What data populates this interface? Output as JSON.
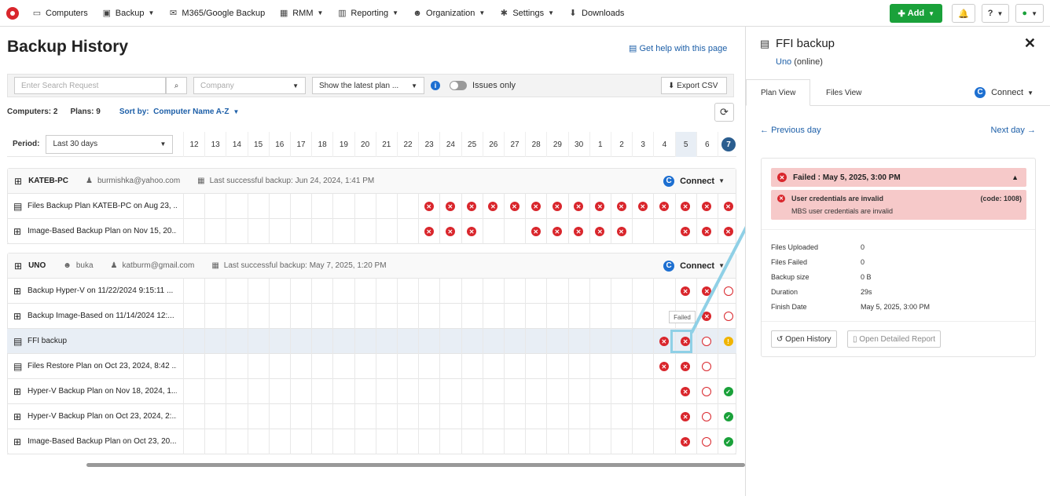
{
  "nav": {
    "items": [
      {
        "label": "Computers",
        "icon": "monitor-icon",
        "caret": false
      },
      {
        "label": "Backup",
        "icon": "backup-icon",
        "caret": true
      },
      {
        "label": "M365/Google Backup",
        "icon": "mail-icon",
        "caret": false
      },
      {
        "label": "RMM",
        "icon": "rmm-icon",
        "caret": true
      },
      {
        "label": "Reporting",
        "icon": "chart-icon",
        "caret": true
      },
      {
        "label": "Organization",
        "icon": "users-icon",
        "caret": true
      },
      {
        "label": "Settings",
        "icon": "gear-icon",
        "caret": true
      },
      {
        "label": "Downloads",
        "icon": "download-icon",
        "caret": false
      }
    ],
    "add_label": "Add"
  },
  "page": {
    "title": "Backup History",
    "help_link": "Get help with this page"
  },
  "filters": {
    "search_placeholder": "Enter Search Request",
    "company_placeholder": "Company",
    "show_select": "Show the latest plan ...",
    "issues_only": "Issues only",
    "export": "Export CSV"
  },
  "stats": {
    "computers": "Computers: 2",
    "plans": "Plans: 9",
    "sort_label": "Sort by:",
    "sort_value": "Computer Name A-Z"
  },
  "period": {
    "label": "Period:",
    "value": "Last 30 days",
    "days": [
      "12",
      "13",
      "14",
      "15",
      "16",
      "17",
      "18",
      "19",
      "20",
      "21",
      "22",
      "23",
      "24",
      "25",
      "26",
      "27",
      "28",
      "29",
      "30",
      "1",
      "2",
      "3",
      "4",
      "5",
      "6",
      "7"
    ]
  },
  "groups": [
    {
      "name": "KATEB-PC",
      "email": "burmishka@yahoo.com",
      "last_backup": "Last successful backup:  Jun 24, 2024, 1:41 PM",
      "connect": "Connect",
      "plans": [
        {
          "name": "Files Backup Plan KATEB-PC on Aug 23, ...",
          "icon": "files-icon",
          "status": {
            "23": "fail",
            "24": "fail",
            "25": "fail",
            "26": "fail",
            "27": "fail",
            "28": "fail",
            "29": "fail",
            "30": "fail",
            "1": "fail",
            "2": "fail",
            "3": "fail",
            "4": "fail",
            "5": "fail",
            "6": "fail",
            "7": "fail"
          }
        },
        {
          "name": "Image-Based Backup Plan on Nov 15, 20...",
          "icon": "windows-icon",
          "status": {
            "23": "fail",
            "24": "fail",
            "25": "fail",
            "28": "fail",
            "29": "fail",
            "30": "fail",
            "1": "fail",
            "2": "fail",
            "5": "fail",
            "6": "fail",
            "7": "fail"
          }
        }
      ]
    },
    {
      "name": "UNO",
      "company": "buka",
      "email": "katburm@gmail.com",
      "last_backup": "Last successful backup:  May 7, 2025, 1:20 PM",
      "connect": "Connect",
      "plans": [
        {
          "name": "Backup Hyper-V on 11/22/2024 9:15:11 ...",
          "icon": "windows-icon",
          "status": {
            "5": "fail",
            "6": "fail",
            "7": "empty"
          }
        },
        {
          "name": "Backup Image-Based on 11/14/2024 12:...",
          "icon": "windows-icon",
          "status": {
            "6": "fail",
            "7": "empty"
          }
        },
        {
          "name": "FFI backup",
          "icon": "files-icon",
          "status": {
            "4": "fail",
            "5": "fail",
            "6": "empty",
            "7": "warn"
          }
        },
        {
          "name": "Files Restore Plan on Oct 23, 2024, 8:42 ...",
          "icon": "files-icon",
          "status": {
            "4": "fail",
            "5": "fail",
            "6": "empty"
          }
        },
        {
          "name": "Hyper-V Backup Plan on Nov 18, 2024, 1...",
          "icon": "windows-icon",
          "status": {
            "5": "fail",
            "6": "empty",
            "7": "ok"
          }
        },
        {
          "name": "Hyper-V Backup Plan on Oct 23, 2024, 2:...",
          "icon": "windows-icon",
          "status": {
            "5": "fail",
            "6": "empty",
            "7": "ok"
          }
        },
        {
          "name": "Image-Based Backup Plan on Oct 23, 20...",
          "icon": "windows-icon",
          "status": {
            "5": "fail",
            "6": "empty",
            "7": "ok"
          }
        }
      ]
    }
  ],
  "tooltip": "Failed",
  "panel": {
    "title": "FFI backup",
    "computer": "Uno",
    "online": "(online)",
    "tabs": [
      "Plan View",
      "Files View"
    ],
    "connect": "Connect",
    "prev_day": "Previous day",
    "next_day": "Next day",
    "fail_title": "Failed : May 5, 2025, 3:00 PM",
    "error_title": "User credentials are invalid",
    "error_code": "(code: 1008)",
    "error_desc": "MBS user credentials are invalid",
    "details": [
      {
        "k": "Files Uploaded",
        "v": "0"
      },
      {
        "k": "Files Failed",
        "v": "0"
      },
      {
        "k": "Backup size",
        "v": "0 B"
      },
      {
        "k": "Duration",
        "v": "29s"
      },
      {
        "k": "Finish Date",
        "v": "May 5, 2025, 3:00 PM"
      }
    ],
    "open_history": "Open History",
    "open_report": "Open Detailed Report"
  }
}
